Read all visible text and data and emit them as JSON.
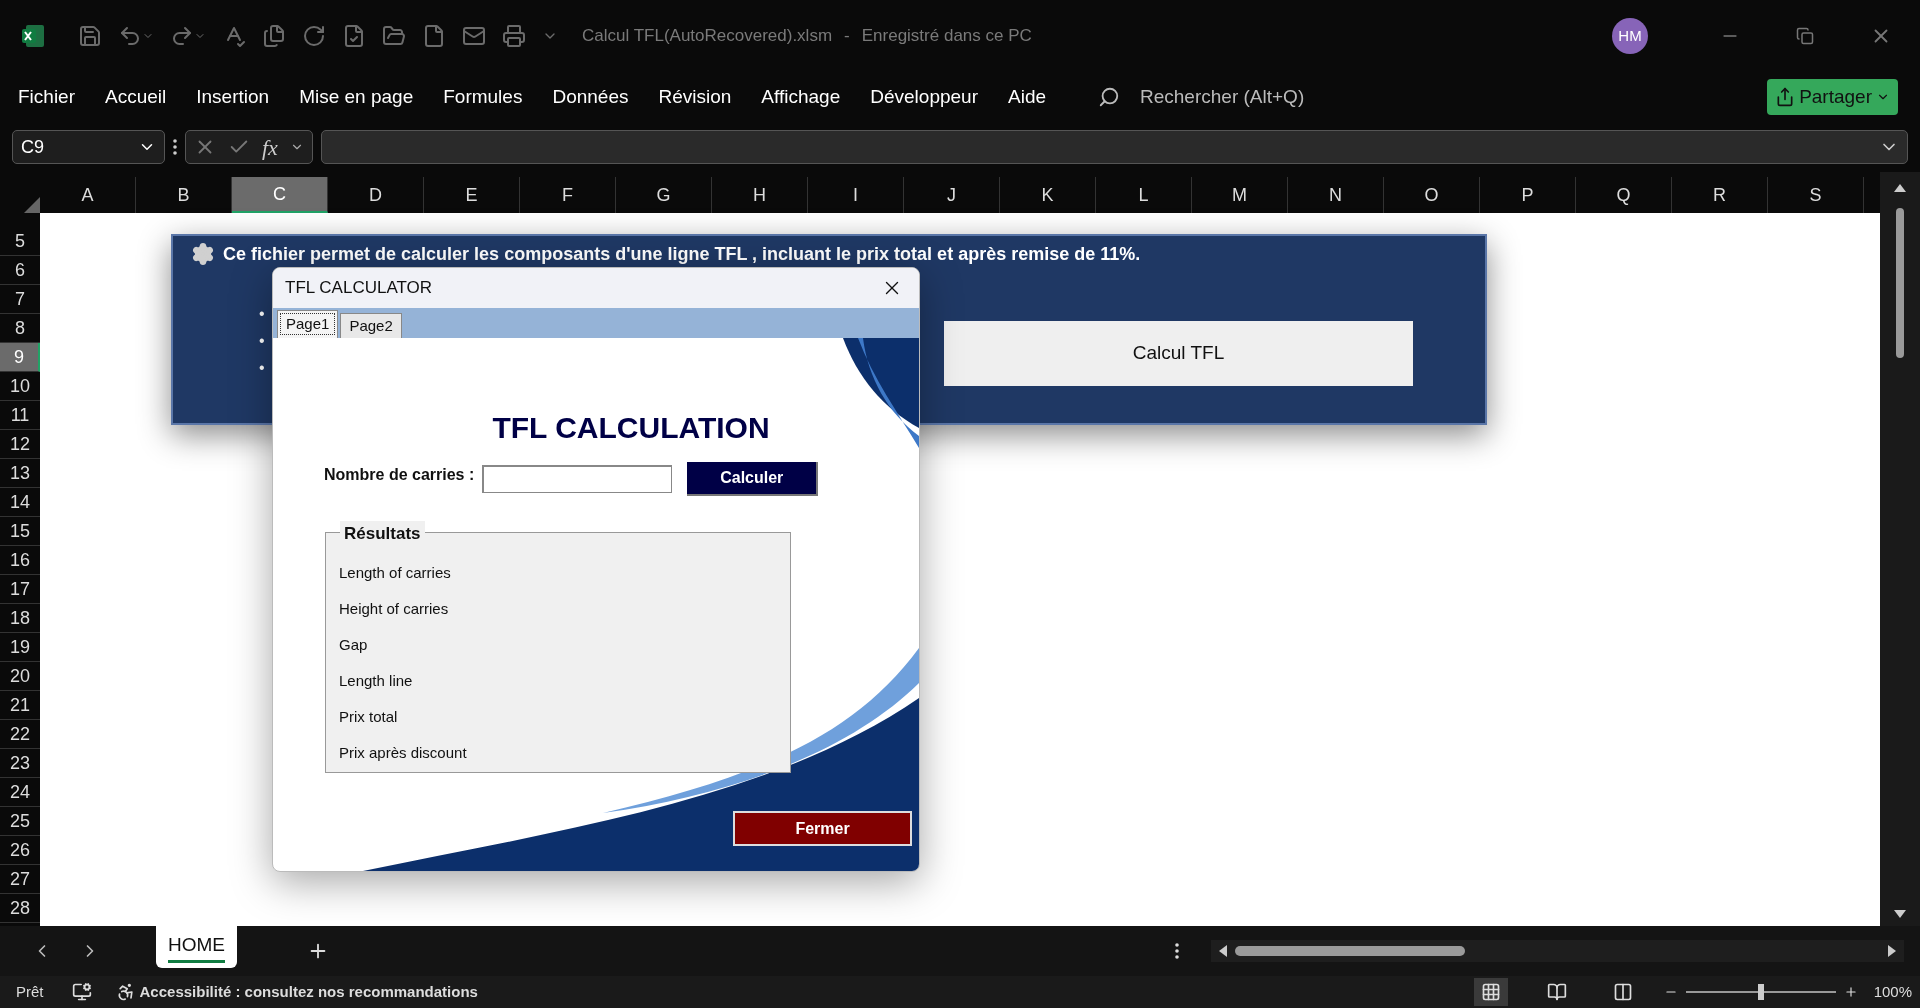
{
  "window": {
    "title": "Calcul TFL(AutoRecovered).xlsm",
    "separator": "-",
    "save_status": "Enregistré dans ce PC",
    "avatar": "HM"
  },
  "menu": [
    {
      "label": "Fichier"
    },
    {
      "label": "Accueil"
    },
    {
      "label": "Insertion"
    },
    {
      "label": "Mise en page"
    },
    {
      "label": "Formules"
    },
    {
      "label": "Données"
    },
    {
      "label": "Révision"
    },
    {
      "label": "Affichage"
    },
    {
      "label": "Développeur"
    },
    {
      "label": "Aide"
    }
  ],
  "search": {
    "placeholder": "Rechercher (Alt+Q)"
  },
  "share_button": "Partager",
  "formula_bar": {
    "name_box": "C9",
    "fx": "fx"
  },
  "columns": [
    {
      "label": "A",
      "selected": false
    },
    {
      "label": "B",
      "selected": false
    },
    {
      "label": "C",
      "selected": true
    },
    {
      "label": "D",
      "selected": false
    },
    {
      "label": "E",
      "selected": false
    },
    {
      "label": "F",
      "selected": false
    },
    {
      "label": "G",
      "selected": false
    },
    {
      "label": "H",
      "selected": false
    },
    {
      "label": "I",
      "selected": false
    },
    {
      "label": "J",
      "selected": false
    },
    {
      "label": "K",
      "selected": false
    },
    {
      "label": "L",
      "selected": false
    },
    {
      "label": "M",
      "selected": false
    },
    {
      "label": "N",
      "selected": false
    },
    {
      "label": "O",
      "selected": false
    },
    {
      "label": "P",
      "selected": false
    },
    {
      "label": "Q",
      "selected": false
    },
    {
      "label": "R",
      "selected": false
    },
    {
      "label": "S",
      "selected": false
    }
  ],
  "rows": [
    {
      "label": "5",
      "selected": false
    },
    {
      "label": "6",
      "selected": false
    },
    {
      "label": "7",
      "selected": false
    },
    {
      "label": "8",
      "selected": false
    },
    {
      "label": "9",
      "selected": true
    },
    {
      "label": "10",
      "selected": false
    },
    {
      "label": "11",
      "selected": false
    },
    {
      "label": "12",
      "selected": false
    },
    {
      "label": "13",
      "selected": false
    },
    {
      "label": "14",
      "selected": false
    },
    {
      "label": "15",
      "selected": false
    },
    {
      "label": "16",
      "selected": false
    },
    {
      "label": "17",
      "selected": false
    },
    {
      "label": "18",
      "selected": false
    },
    {
      "label": "19",
      "selected": false
    },
    {
      "label": "20",
      "selected": false
    },
    {
      "label": "21",
      "selected": false
    },
    {
      "label": "22",
      "selected": false
    },
    {
      "label": "23",
      "selected": false
    },
    {
      "label": "24",
      "selected": false
    },
    {
      "label": "25",
      "selected": false
    },
    {
      "label": "26",
      "selected": false
    },
    {
      "label": "27",
      "selected": false
    },
    {
      "label": "28",
      "selected": false
    }
  ],
  "banner": {
    "text": "Ce fichier permet de calculer les composants d'une ligne TFL , incluant le prix total et après remise de 11%.",
    "bullets": [
      "•",
      "•",
      "•"
    ],
    "button": "Calcul TFL"
  },
  "dialog": {
    "title": "TFL CALCULATOR",
    "tabs": [
      {
        "label": "Page1",
        "selected": true
      },
      {
        "label": "Page2",
        "selected": false
      }
    ],
    "heading": "TFL CALCULATION",
    "input_label": "Nombre de carries :",
    "calc_button": "Calculer",
    "results": {
      "title": "Résultats",
      "items": [
        "Length of carries",
        "Height of carries",
        "Gap",
        "Length line",
        "Prix total",
        "Prix après discount"
      ]
    },
    "close_button": "Fermer"
  },
  "sheet_tabs": [
    {
      "label": "HOME",
      "selected": true
    }
  ],
  "status_bar": {
    "ready": "Prêt",
    "accessibility": "Accessibilité : consultez nos recommandations",
    "views": [
      {
        "kind": "normal",
        "selected": true
      },
      {
        "kind": "page_layout",
        "selected": false
      },
      {
        "kind": "page_break",
        "selected": false
      }
    ],
    "zoom": {
      "level": 0.5,
      "reading": "100%"
    }
  }
}
